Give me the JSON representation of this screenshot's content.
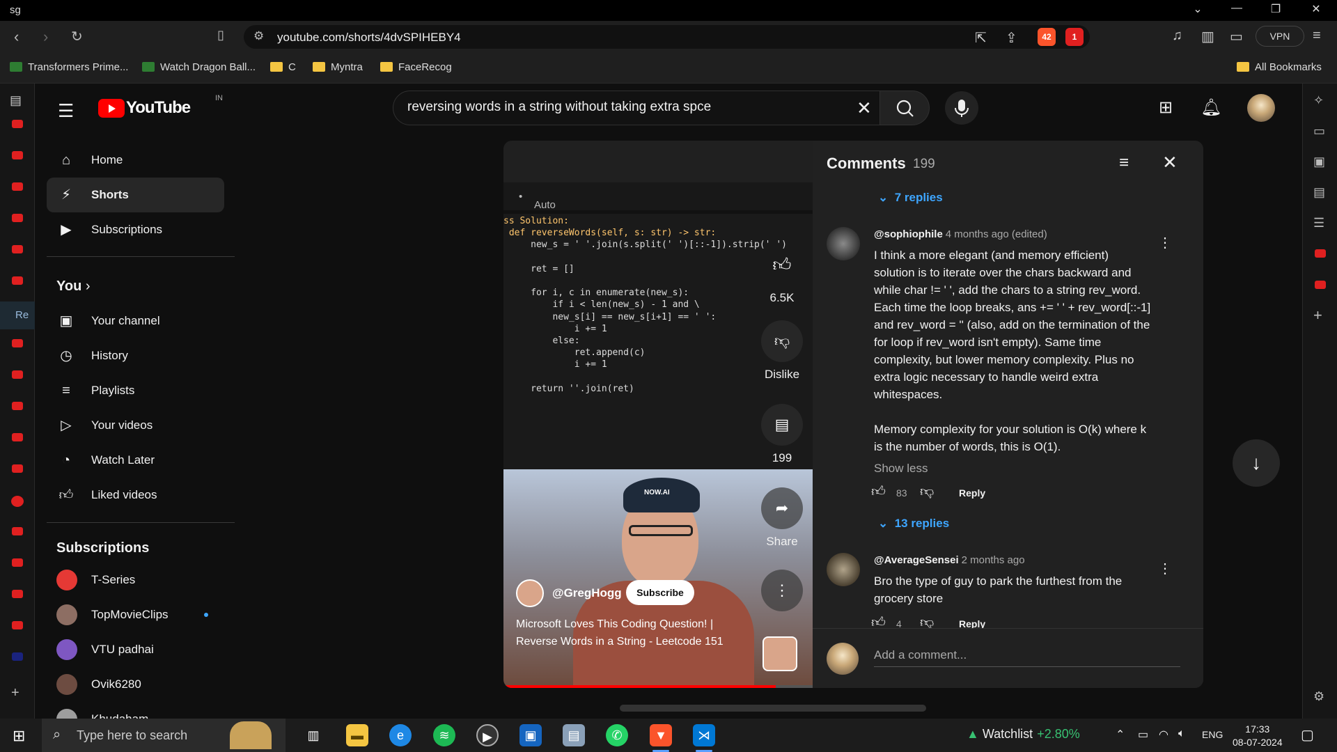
{
  "browser": {
    "profile": "sg",
    "url": "youtube.com/shorts/4dvSPIHEBY4",
    "shield_count": "42",
    "alert_count": "1",
    "vpn_label": "VPN",
    "bookmarks": [
      "Transformers Prime...",
      "Watch Dragon Ball...",
      "C",
      "Myntra",
      "FaceRecog"
    ],
    "all_bookmarks": "All Bookmarks",
    "left_strip_label": "Re"
  },
  "youtube": {
    "logo_text": "YouTube",
    "country_code": "IN",
    "search_value": "reversing words in a string without taking extra spce"
  },
  "sidebar": {
    "main": [
      {
        "label": "Home",
        "icon": "home-icon"
      },
      {
        "label": "Shorts",
        "icon": "shorts-icon"
      },
      {
        "label": "Subscriptions",
        "icon": "subscriptions-icon"
      }
    ],
    "you_header": "You",
    "you_items": [
      {
        "label": "Your channel",
        "icon": "channel-icon"
      },
      {
        "label": "History",
        "icon": "history-icon"
      },
      {
        "label": "Playlists",
        "icon": "playlists-icon"
      },
      {
        "label": "Your videos",
        "icon": "your-videos-icon"
      },
      {
        "label": "Watch Later",
        "icon": "watch-later-icon"
      },
      {
        "label": "Liked videos",
        "icon": "liked-icon"
      }
    ],
    "subs_header": "Subscriptions",
    "subs": [
      {
        "label": "T-Series",
        "color": "#e53935"
      },
      {
        "label": "TopMovieClips",
        "color": "#8d6e63"
      },
      {
        "label": "VTU padhai",
        "color": "#7e57c2"
      },
      {
        "label": "Ovik6280",
        "color": "#6d4c41"
      },
      {
        "label": "Khudaham",
        "color": "#9e9e9e"
      }
    ]
  },
  "short": {
    "auto_label": "Auto",
    "code_lines": [
      "ss Solution:",
      " def reverseWords(self, s: str) -> str:",
      "     new_s = ' '.join(s.split(' ')[::-1]).strip(' ')",
      "",
      "     ret = []",
      "",
      "     for i, c in enumerate(new_s):",
      "         if i < len(new_s) - 1 and \\",
      "         new_s[i] == new_s[i+1] == ' ':",
      "             i += 1",
      "         else:",
      "             ret.append(c)",
      "             i += 1",
      "",
      "     return ''.join(ret)"
    ],
    "channel": "@GregHogg",
    "subscribe_label": "Subscribe",
    "title": "Microsoft Loves This Coding Question! | Reverse Words in a String - Leetcode 151",
    "progress": 0.88,
    "cap_text": "NOW.AI",
    "likes": "6.5K",
    "dislike_label": "Dislike",
    "comment_count": "199",
    "share_label": "Share"
  },
  "comments": {
    "title": "Comments",
    "count": "199",
    "replies_top": "7 replies",
    "items": [
      {
        "user": "@sophiophile",
        "time": "4 months ago (edited)",
        "text": "I think a more elegant (and memory efficient) solution is to iterate over the chars backward and while char != ' ', add the chars to a string rev_word. Each time the loop breaks, ans += ' ' + rev_word[::-1] and rev_word = '' (also, add on the termination of the for loop if rev_word isn't empty). Same time complexity, but lower memory complexity. Plus no extra logic necessary to handle weird extra whitespaces.",
        "text2": "Memory complexity for your solution is O(k) where k is the number of words, this is O(1).",
        "show_less": "Show less",
        "likes": "83",
        "reply_label": "Reply",
        "replies": "13 replies"
      },
      {
        "user": "@AverageSensei",
        "time": "2 months ago",
        "text": "Bro the type of guy to park the furthest from the grocery store",
        "likes": "4",
        "reply_label": "Reply"
      }
    ],
    "add_placeholder": "Add a comment..."
  },
  "taskbar": {
    "search_placeholder": "Type here to search",
    "watchlist": "Watchlist",
    "watchlist_change": "+2.80%",
    "lang": "ENG",
    "time": "17:33",
    "date": "08-07-2024"
  }
}
